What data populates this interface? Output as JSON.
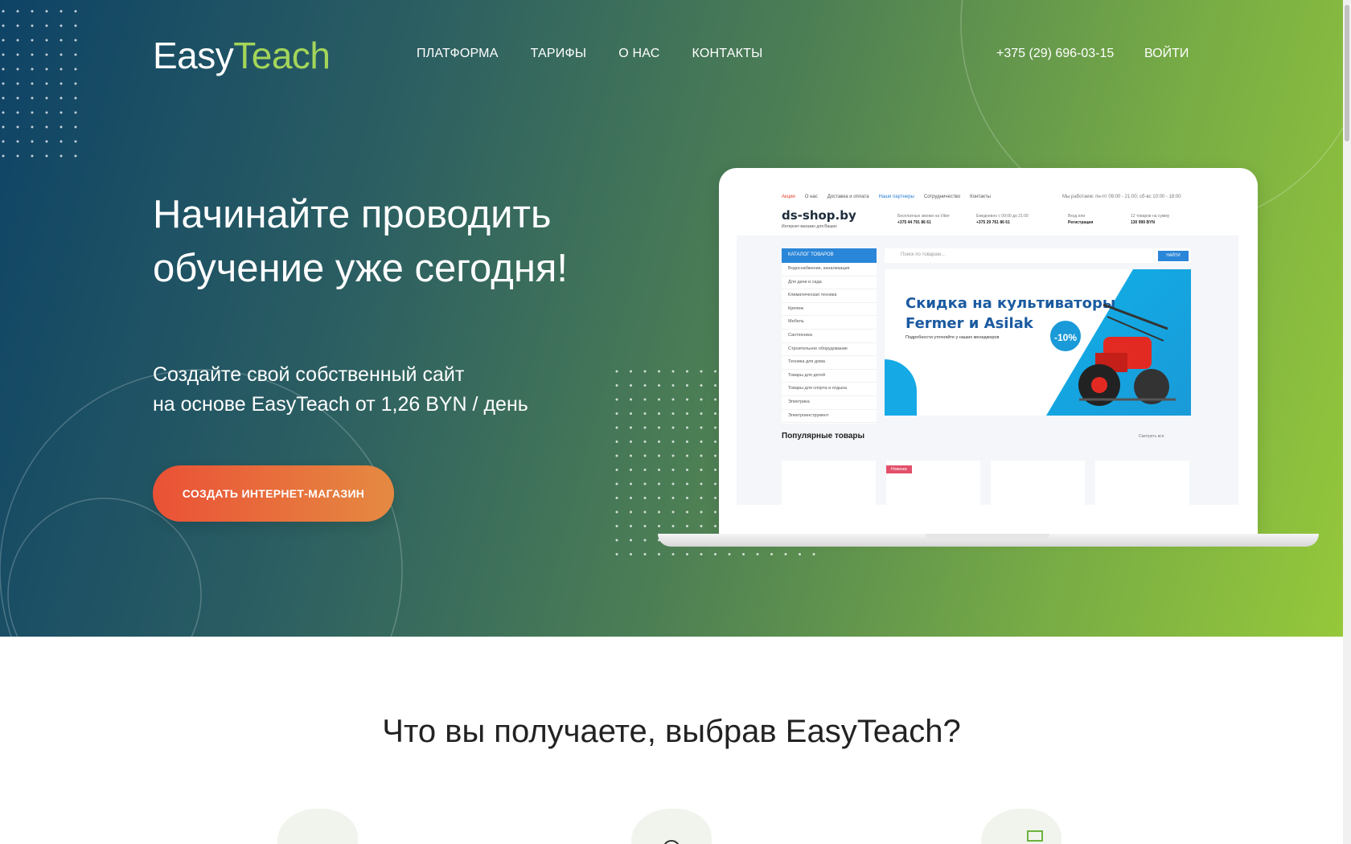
{
  "logo": {
    "part1": "Easy",
    "part2": "Teach"
  },
  "nav": {
    "items": [
      {
        "label": "ПЛАТФОРМА"
      },
      {
        "label": "ТАРИФЫ"
      },
      {
        "label": "О НАС"
      },
      {
        "label": "КОНТАКТЫ"
      }
    ]
  },
  "header": {
    "phone": "+375 (29) 696-03-15",
    "login": "ВОЙТИ"
  },
  "hero": {
    "headline": "Начинайте проводить обучение уже сегодня!",
    "sub_line1": "Создайте свой собственный сайт",
    "sub_line2": "на основе EasyTeach от 1,26 BYN / день",
    "cta": "СОЗДАТЬ ИНТЕРНЕТ-МАГАЗИН"
  },
  "mockup": {
    "menu": [
      "Акции",
      "О нас",
      "Доставка и оплата",
      "Наши партнеры",
      "Сотрудничество",
      "Контакты"
    ],
    "hours": "Мы работаем: пн-пт 09:00 - 21:00; сб-вс 10:00 - 18:00",
    "shop_name": "ds-shop.by",
    "shop_sub": "Интернет-магазин для Ваших",
    "phone1_label": "Бесплатные звонки на Viber",
    "phone1": "+375 44 791 86 61",
    "phone2_label": "Ежедневно с 09:00 до 21:00",
    "phone2": "+375 29 761 86 61",
    "account_label": "Вход или",
    "account": "Регистрация",
    "cart_label": "12 товаров на сумму",
    "cart": "130 999 BYN",
    "catalog": "КАТАЛОГ ТОВАРОВ",
    "categories": [
      "Водоснабжение, канализация",
      "Для дачи и сада",
      "Климатическая техника",
      "Крепеж",
      "Мебель",
      "Сантехника",
      "Строительное оборудование",
      "Техника для дома",
      "Товары для детей",
      "Товары для спорта и отдыха",
      "Электрика",
      "Электроинструмент"
    ],
    "search_placeholder": "Поиск по товарам...",
    "search_button": "НАЙТИ",
    "banner_title1": "Скидка на культиваторы",
    "banner_title2": "Fermer и Asilak",
    "banner_sub": "Подробности уточняйте у наших менеджеров",
    "banner_discount": "-10%",
    "popular": "Популярные товары",
    "see_all": "Смотреть все",
    "badge_new": "Новинка"
  },
  "features": {
    "title": "Что вы получаете, выбрав EasyTeach?"
  },
  "colors": {
    "gradient_start": "#0e4366",
    "gradient_end": "#95c83a",
    "accent_green": "#a3d55a",
    "cta_start": "#ea5136",
    "cta_end": "#e58a42"
  }
}
